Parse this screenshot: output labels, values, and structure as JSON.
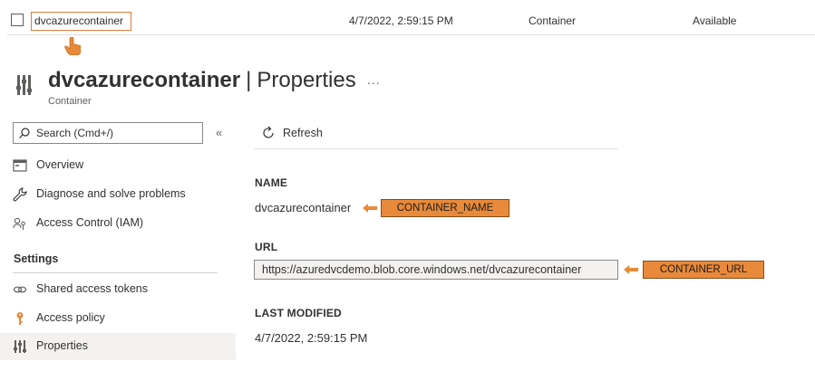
{
  "list_row": {
    "name": "dvcazurecontainer",
    "modified": "4/7/2022, 2:59:15 PM",
    "type": "Container",
    "status": "Available"
  },
  "header": {
    "resource_name": "dvcazurecontainer",
    "separator": "|",
    "page": "Properties",
    "more": "...",
    "subtitle": "Container"
  },
  "sidebar": {
    "search_placeholder": "Search (Cmd+/)",
    "collapse_label": "«",
    "items": [
      {
        "label": "Overview",
        "icon": "overview-icon"
      },
      {
        "label": "Diagnose and solve problems",
        "icon": "wrench-icon"
      },
      {
        "label": "Access Control (IAM)",
        "icon": "iam-icon"
      }
    ],
    "settings_heading": "Settings",
    "settings_items": [
      {
        "label": "Shared access tokens",
        "icon": "link-icon"
      },
      {
        "label": "Access policy",
        "icon": "key-icon"
      },
      {
        "label": "Properties",
        "icon": "properties-icon",
        "active": true
      }
    ]
  },
  "toolbar": {
    "refresh_label": "Refresh"
  },
  "properties": {
    "name_label": "NAME",
    "name_value": "dvcazurecontainer",
    "url_label": "URL",
    "url_value": "https://azuredvcdemo.blob.core.windows.net/dvcazurecontainer",
    "modified_label": "LAST MODIFIED",
    "modified_value": "4/7/2022, 2:59:15 PM"
  },
  "annotations": {
    "name_tag": "CONTAINER_NAME",
    "url_tag": "CONTAINER_URL",
    "color": "#e98a3a"
  }
}
